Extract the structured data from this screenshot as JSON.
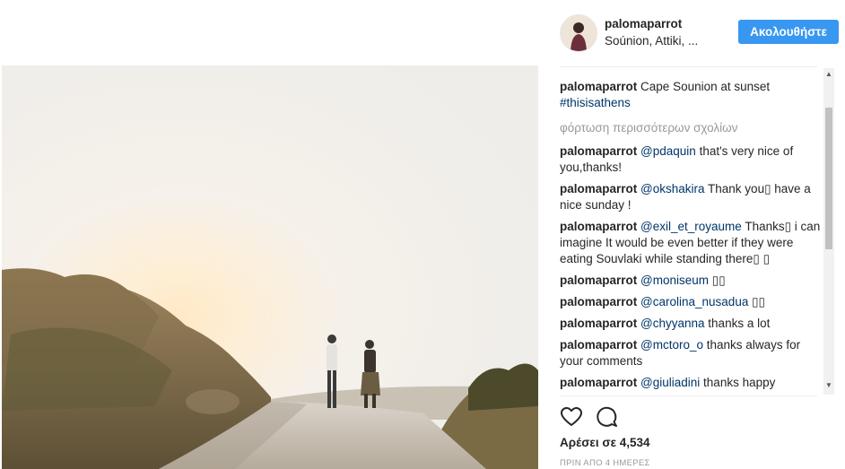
{
  "post": {
    "username": "palomaparrot",
    "location": "Soúnion, Attiki, ...",
    "follow_label": "Ακολουθήστε",
    "caption": {
      "user": "palomaparrot",
      "text": "Cape Sounion at sunset ",
      "hashtag": "#thisisathens"
    },
    "load_more": "φόρτωση περισσότερων σχολίων",
    "comments": [
      {
        "user": "palomaparrot",
        "mention": "@pdaquin",
        "text": " that's very nice of you,thanks!"
      },
      {
        "user": "palomaparrot",
        "mention": "@okshakira",
        "text": " Thank you▯ have a nice sunday !"
      },
      {
        "user": "palomaparrot",
        "mention": "@exil_et_royaume",
        "text": " Thanks▯ i can imagine It would be even better if they were eating Souvlaki while standing there▯ ▯"
      },
      {
        "user": "palomaparrot",
        "mention": "@moniseum",
        "text": " ▯▯"
      },
      {
        "user": "palomaparrot",
        "mention": "@carolina_nusadua",
        "text": " ▯▯"
      },
      {
        "user": "palomaparrot",
        "mention": "@chyyanna",
        "text": " thanks a lot"
      },
      {
        "user": "palomaparrot",
        "mention": "@mctoro_o",
        "text": " thanks always for your comments"
      },
      {
        "user": "palomaparrot",
        "mention": "@giuliadini",
        "text": " thanks happy"
      }
    ],
    "likes": "Αρέσει σε 4,534",
    "timestamp": "ΠΡΙΝ ΑΠΟ 4 ΗΜΕΡΕΣ"
  },
  "icons": {
    "like": "heart-icon",
    "comment": "comment-icon"
  },
  "colors": {
    "accent": "#3897f0",
    "link": "#003569",
    "muted": "#999999"
  }
}
